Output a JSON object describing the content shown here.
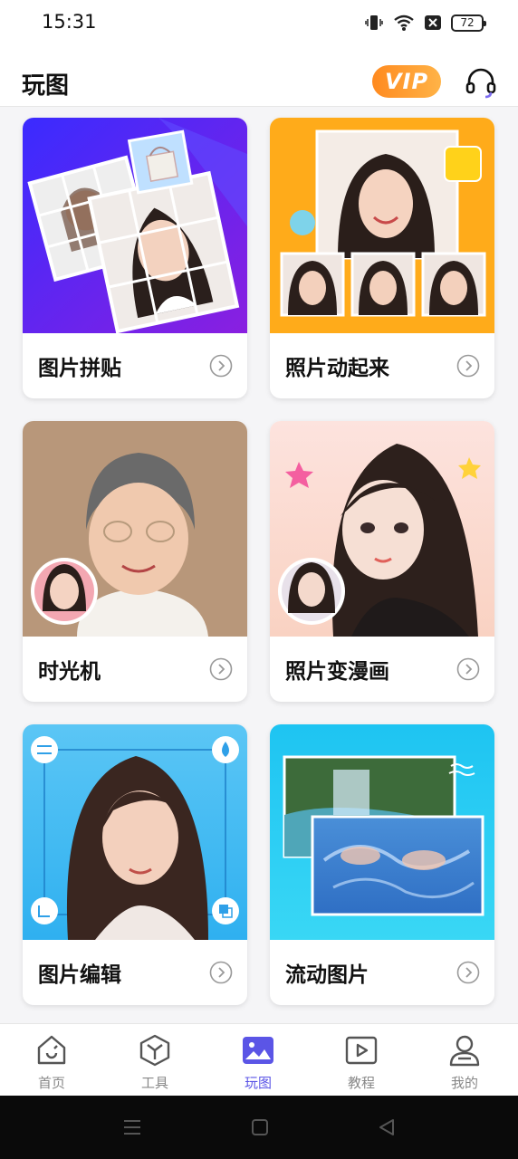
{
  "status": {
    "time": "15:31",
    "battery": "72"
  },
  "header": {
    "title": "玩图",
    "vip_label": "VIP"
  },
  "cards": [
    {
      "label": "图片拼贴"
    },
    {
      "label": "照片动起来"
    },
    {
      "label": "时光机"
    },
    {
      "label": "照片变漫画"
    },
    {
      "label": "图片编辑"
    },
    {
      "label": "流动图片"
    }
  ],
  "nav": [
    {
      "label": "首页"
    },
    {
      "label": "工具"
    },
    {
      "label": "玩图"
    },
    {
      "label": "教程"
    },
    {
      "label": "我的"
    }
  ],
  "colors": {
    "accent": "#5b55e6",
    "vip": "#ff8a1f"
  }
}
